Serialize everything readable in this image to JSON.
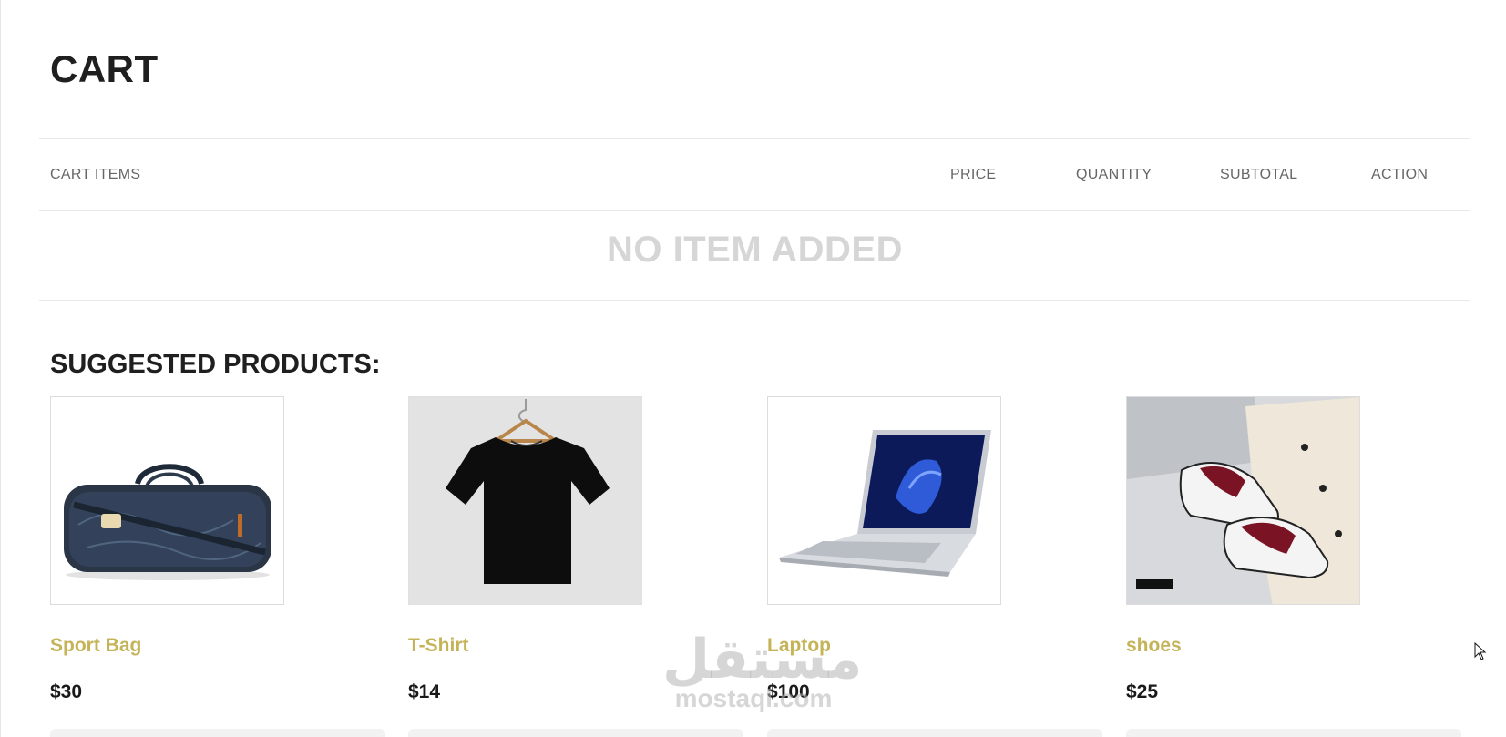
{
  "page": {
    "title": "CART"
  },
  "cart_table": {
    "headers": [
      "CART ITEMS",
      "PRICE",
      "QUANTITY",
      "SUBTOTAL",
      "ACTION"
    ],
    "empty_message": "NO ITEM ADDED"
  },
  "suggested": {
    "heading": "SUGGESTED PRODUCTS:",
    "products": [
      {
        "name": "Sport Bag",
        "price": "$30",
        "image_icon": "sport-bag-image"
      },
      {
        "name": "T-Shirt",
        "price": "$14",
        "image_icon": "tshirt-image"
      },
      {
        "name": "Laptop",
        "price": "$100",
        "image_icon": "laptop-image"
      },
      {
        "name": "shoes",
        "price": "$25",
        "image_icon": "shoes-image"
      }
    ]
  },
  "watermark": {
    "arabic": "مستقل",
    "latin": "mostaql.com"
  },
  "colors": {
    "product_name": "#c5b358",
    "empty_text": "#d6d6d6",
    "header_text": "#666666"
  }
}
